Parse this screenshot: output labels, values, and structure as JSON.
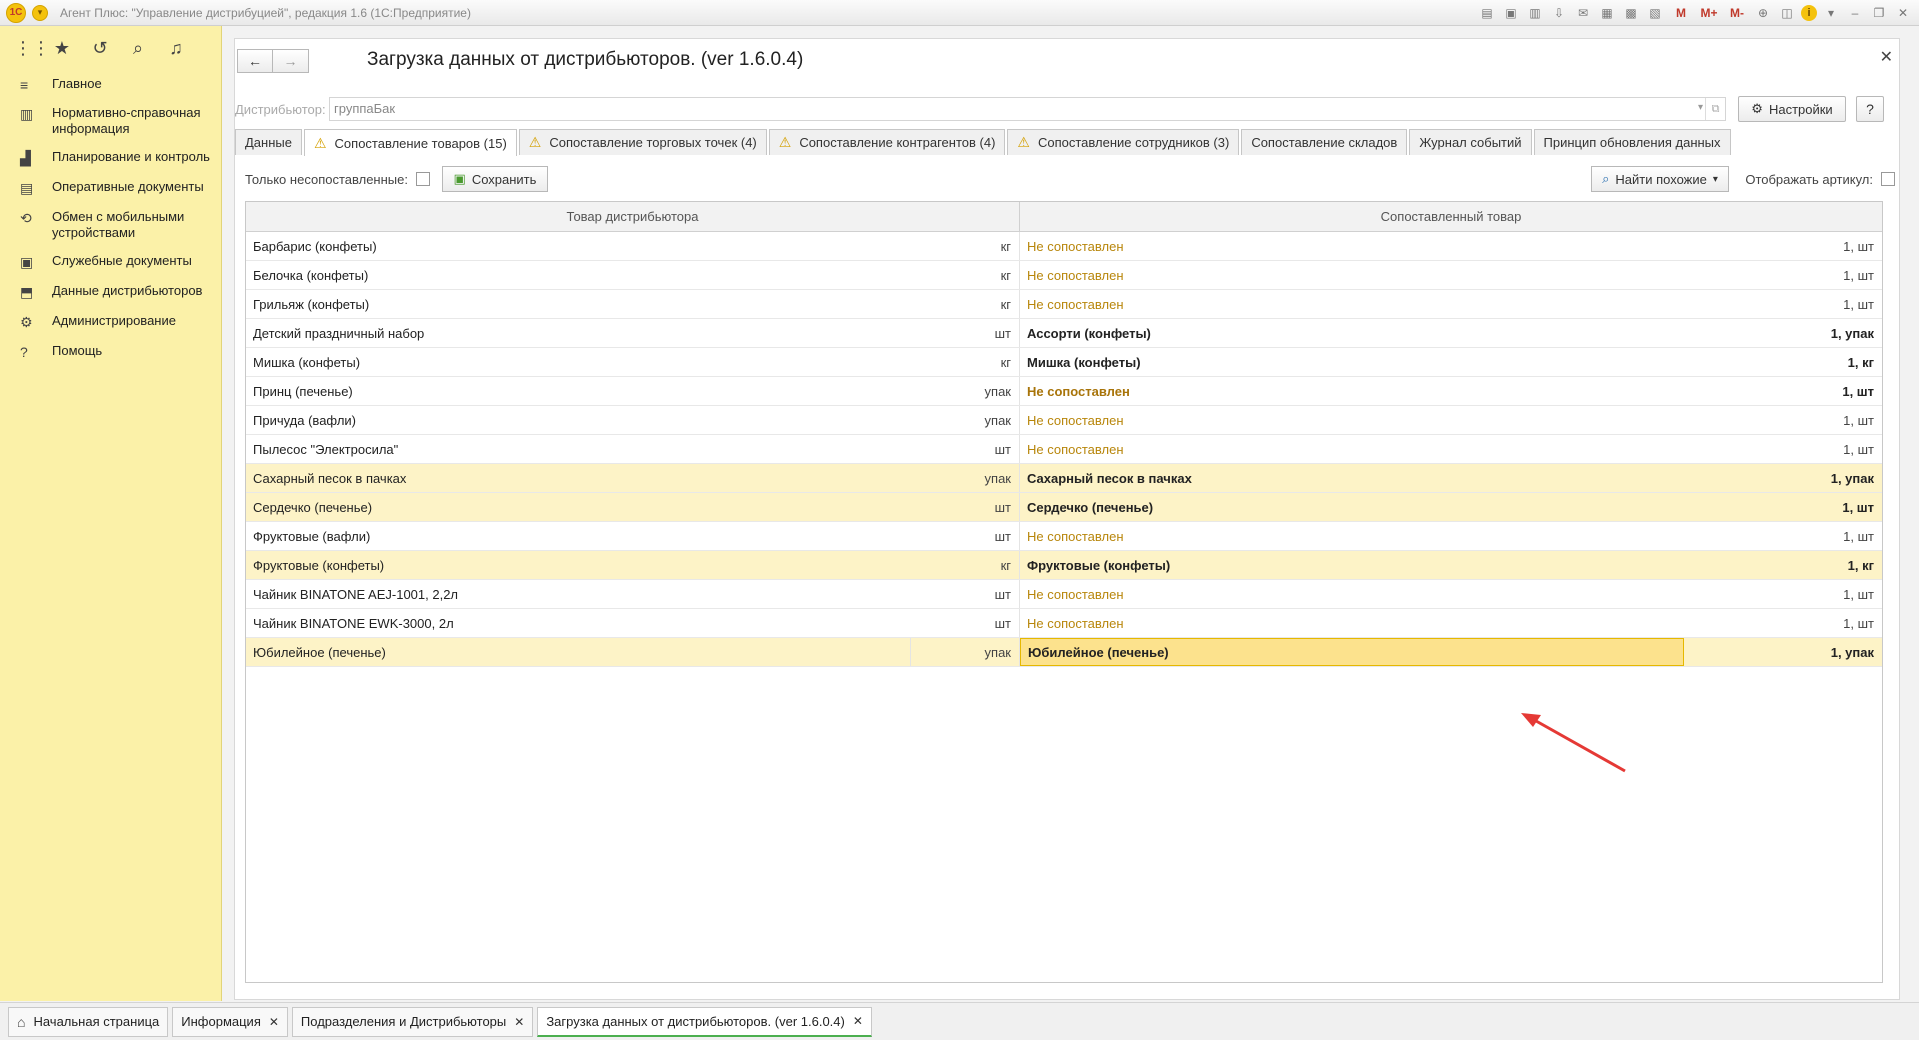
{
  "window": {
    "logo": "1С",
    "title": "Агент Плюс: \"Управление дистрибуцией\", редакция 1.6  (1С:Предприятие)",
    "toolbar_m": [
      "M",
      "M+",
      "M-"
    ]
  },
  "sidebar": {
    "items": [
      {
        "label": "Главное",
        "icon": "menu-lines"
      },
      {
        "label": "Нормативно-справочная информация",
        "icon": "grid"
      },
      {
        "label": "Планирование и контроль",
        "icon": "chart"
      },
      {
        "label": "Оперативные документы",
        "icon": "document"
      },
      {
        "label": "Обмен с мобильными устройствами",
        "icon": "sync"
      },
      {
        "label": "Служебные документы",
        "icon": "docs"
      },
      {
        "label": "Данные дистрибьюторов",
        "icon": "data"
      },
      {
        "label": "Администрирование",
        "icon": "gear"
      },
      {
        "label": "Помощь",
        "icon": "question"
      }
    ]
  },
  "page": {
    "title": "Загрузка данных от дистрибьюторов. (ver 1.6.0.4)",
    "distributor_label": "Дистрибьютор:",
    "distributor_value": "группаБак",
    "settings_label": "Настройки",
    "help_label": "?"
  },
  "tabs": [
    {
      "label": "Данные",
      "warn": false,
      "active": false
    },
    {
      "label": "Сопоставление товаров (15)",
      "warn": true,
      "active": true
    },
    {
      "label": "Сопоставление торговых точек (4)",
      "warn": true,
      "active": false
    },
    {
      "label": "Сопоставление контрагентов (4)",
      "warn": true,
      "active": false
    },
    {
      "label": "Сопоставление сотрудников (3)",
      "warn": true,
      "active": false
    },
    {
      "label": "Сопоставление складов",
      "warn": false,
      "active": false
    },
    {
      "label": "Журнал событий",
      "warn": false,
      "active": false
    },
    {
      "label": "Принцип обновления данных",
      "warn": false,
      "active": false
    }
  ],
  "toolbar": {
    "only_unmatched_label": "Только несопоставленные:",
    "save_label": "Сохранить",
    "find_similar_label": "Найти похожие",
    "show_article_label": "Отображать артикул:"
  },
  "table": {
    "headers": [
      "Товар дистрибьютора",
      "Сопоставленный товар"
    ],
    "rows": [
      {
        "name": "Барбарис (конфеты)",
        "unit": "кг",
        "match": "Не сопоставлен",
        "qty": "1, шт",
        "matched": false,
        "bold": false,
        "hl": false
      },
      {
        "name": "Белочка (конфеты)",
        "unit": "кг",
        "match": "Не сопоставлен",
        "qty": "1, шт",
        "matched": false,
        "bold": false,
        "hl": false
      },
      {
        "name": "Грильяж (конфеты)",
        "unit": "кг",
        "match": "Не сопоставлен",
        "qty": "1, шт",
        "matched": false,
        "bold": false,
        "hl": false
      },
      {
        "name": "Детский праздничный набор",
        "unit": "шт",
        "match": "Ассорти (конфеты)",
        "qty": "1, упак",
        "matched": true,
        "bold": true,
        "hl": false
      },
      {
        "name": "Мишка (конфеты)",
        "unit": "кг",
        "match": "Мишка (конфеты)",
        "qty": "1, кг",
        "matched": true,
        "bold": true,
        "hl": false
      },
      {
        "name": "Принц (печенье)",
        "unit": "упак",
        "match": "Не сопоставлен",
        "qty": "1, шт",
        "matched": false,
        "bold": true,
        "hl": false
      },
      {
        "name": "Причуда (вафли)",
        "unit": "упак",
        "match": "Не сопоставлен",
        "qty": "1, шт",
        "matched": false,
        "bold": false,
        "hl": false
      },
      {
        "name": "Пылесос \"Электросила\"",
        "unit": "шт",
        "match": "Не сопоставлен",
        "qty": "1, шт",
        "matched": false,
        "bold": false,
        "hl": false
      },
      {
        "name": "Сахарный песок в пачках",
        "unit": "упак",
        "match": "Сахарный песок в пачках",
        "qty": "1, упак",
        "matched": true,
        "bold": true,
        "hl": true
      },
      {
        "name": "Сердечко (печенье)",
        "unit": "шт",
        "match": "Сердечко (печенье)",
        "qty": "1, шт",
        "matched": true,
        "bold": true,
        "hl": true
      },
      {
        "name": "Фруктовые (вафли)",
        "unit": "шт",
        "match": "Не сопоставлен",
        "qty": "1, шт",
        "matched": false,
        "bold": false,
        "hl": false
      },
      {
        "name": "Фруктовые (конфеты)",
        "unit": "кг",
        "match": "Фруктовые (конфеты)",
        "qty": "1, кг",
        "matched": true,
        "bold": true,
        "hl": true
      },
      {
        "name": "Чайник BINATONE  AEJ-1001,  2,2л",
        "unit": "шт",
        "match": "Не сопоставлен",
        "qty": "1, шт",
        "matched": false,
        "bold": false,
        "hl": false
      },
      {
        "name": "Чайник BINATONE  EWK-3000,  2л",
        "unit": "шт",
        "match": "Не сопоставлен",
        "qty": "1, шт",
        "matched": false,
        "bold": false,
        "hl": false
      },
      {
        "name": "Юбилейное (печенье)",
        "unit": "упак",
        "match": "Юбилейное (печенье)",
        "qty": "1, упак",
        "matched": true,
        "bold": true,
        "hl": true,
        "selected": true
      }
    ]
  },
  "bottom_tabs": [
    {
      "label": "Начальная страница",
      "home": true,
      "closable": false,
      "active": false
    },
    {
      "label": "Информация",
      "home": false,
      "closable": true,
      "active": false
    },
    {
      "label": "Подразделения и Дистрибьюторы",
      "home": false,
      "closable": true,
      "active": false
    },
    {
      "label": "Загрузка данных от дистрибьюторов. (ver 1.6.0.4)",
      "home": false,
      "closable": true,
      "active": true
    }
  ],
  "colors": {
    "sidebar_bg": "#fbf1a8",
    "unmatched_text": "#b8860b",
    "highlight_row": "#fdf3c7",
    "selected_cell": "#fce28d",
    "annotation_arrow": "#e53935"
  }
}
